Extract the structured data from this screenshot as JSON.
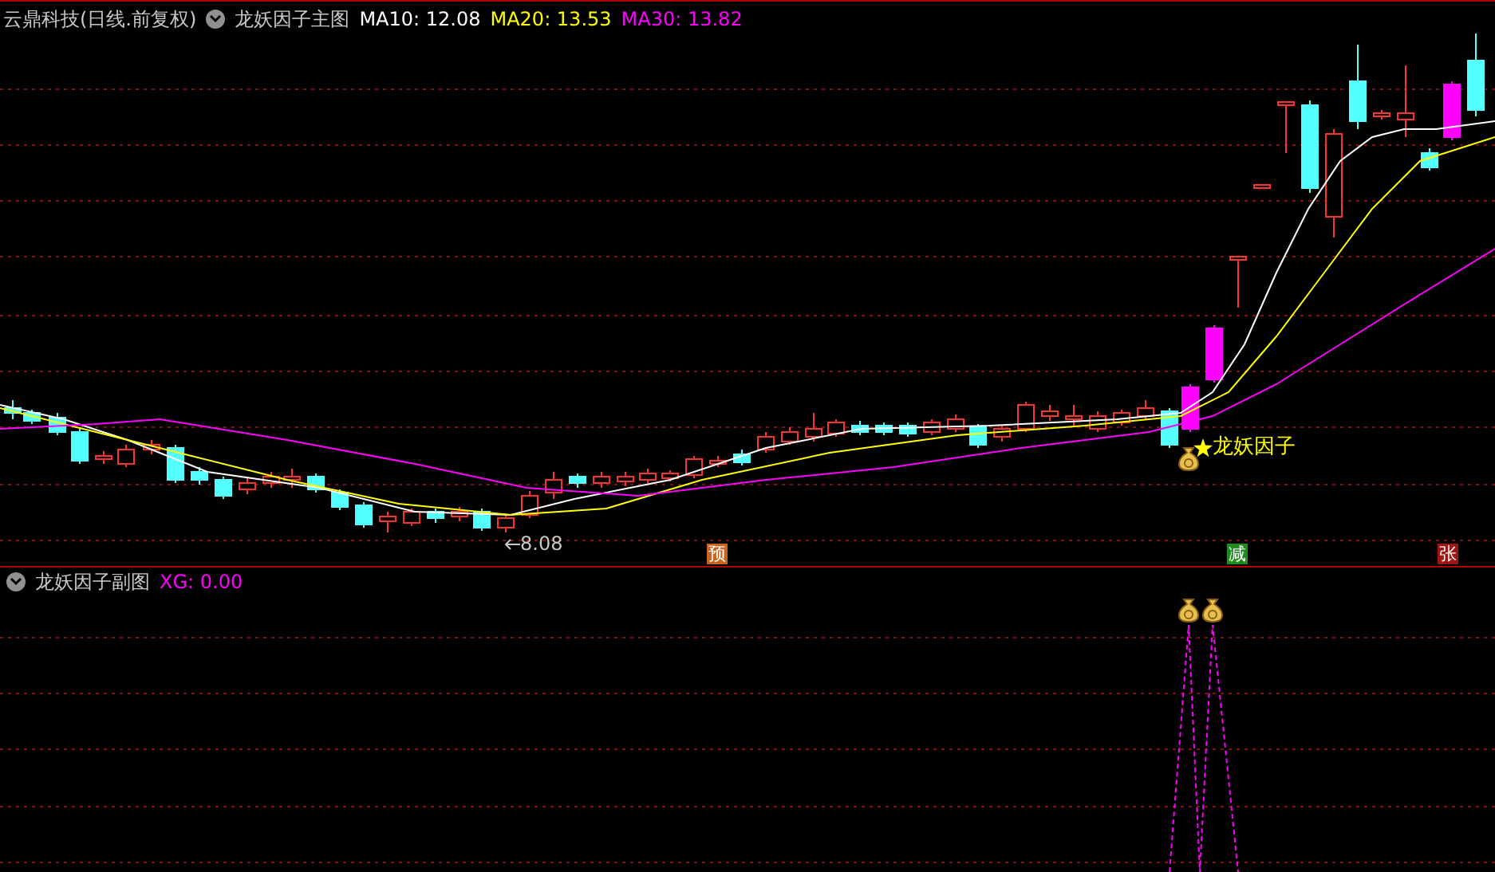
{
  "main_chart": {
    "stock_title": "云鼎科技(日线.前复权)",
    "indicator_name": "龙妖因子主图",
    "ma_readings": [
      {
        "label": "MA10: 12.08",
        "color": "#ffffff"
      },
      {
        "label": "MA20: 13.53",
        "color": "#ffff00"
      },
      {
        "label": "MA30: 13.82",
        "color": "#ff00ff"
      }
    ],
    "low_label": "8.08",
    "signal_label": "龙妖因子",
    "markers": [
      {
        "label": "预",
        "color": "#c8641e"
      },
      {
        "label": "减",
        "color": "#1e8c1e"
      },
      {
        "label": "张",
        "color": "#a01414"
      }
    ]
  },
  "sub_chart": {
    "indicator_name": "龙妖因子副图",
    "reading": "XG: 0.00"
  }
}
